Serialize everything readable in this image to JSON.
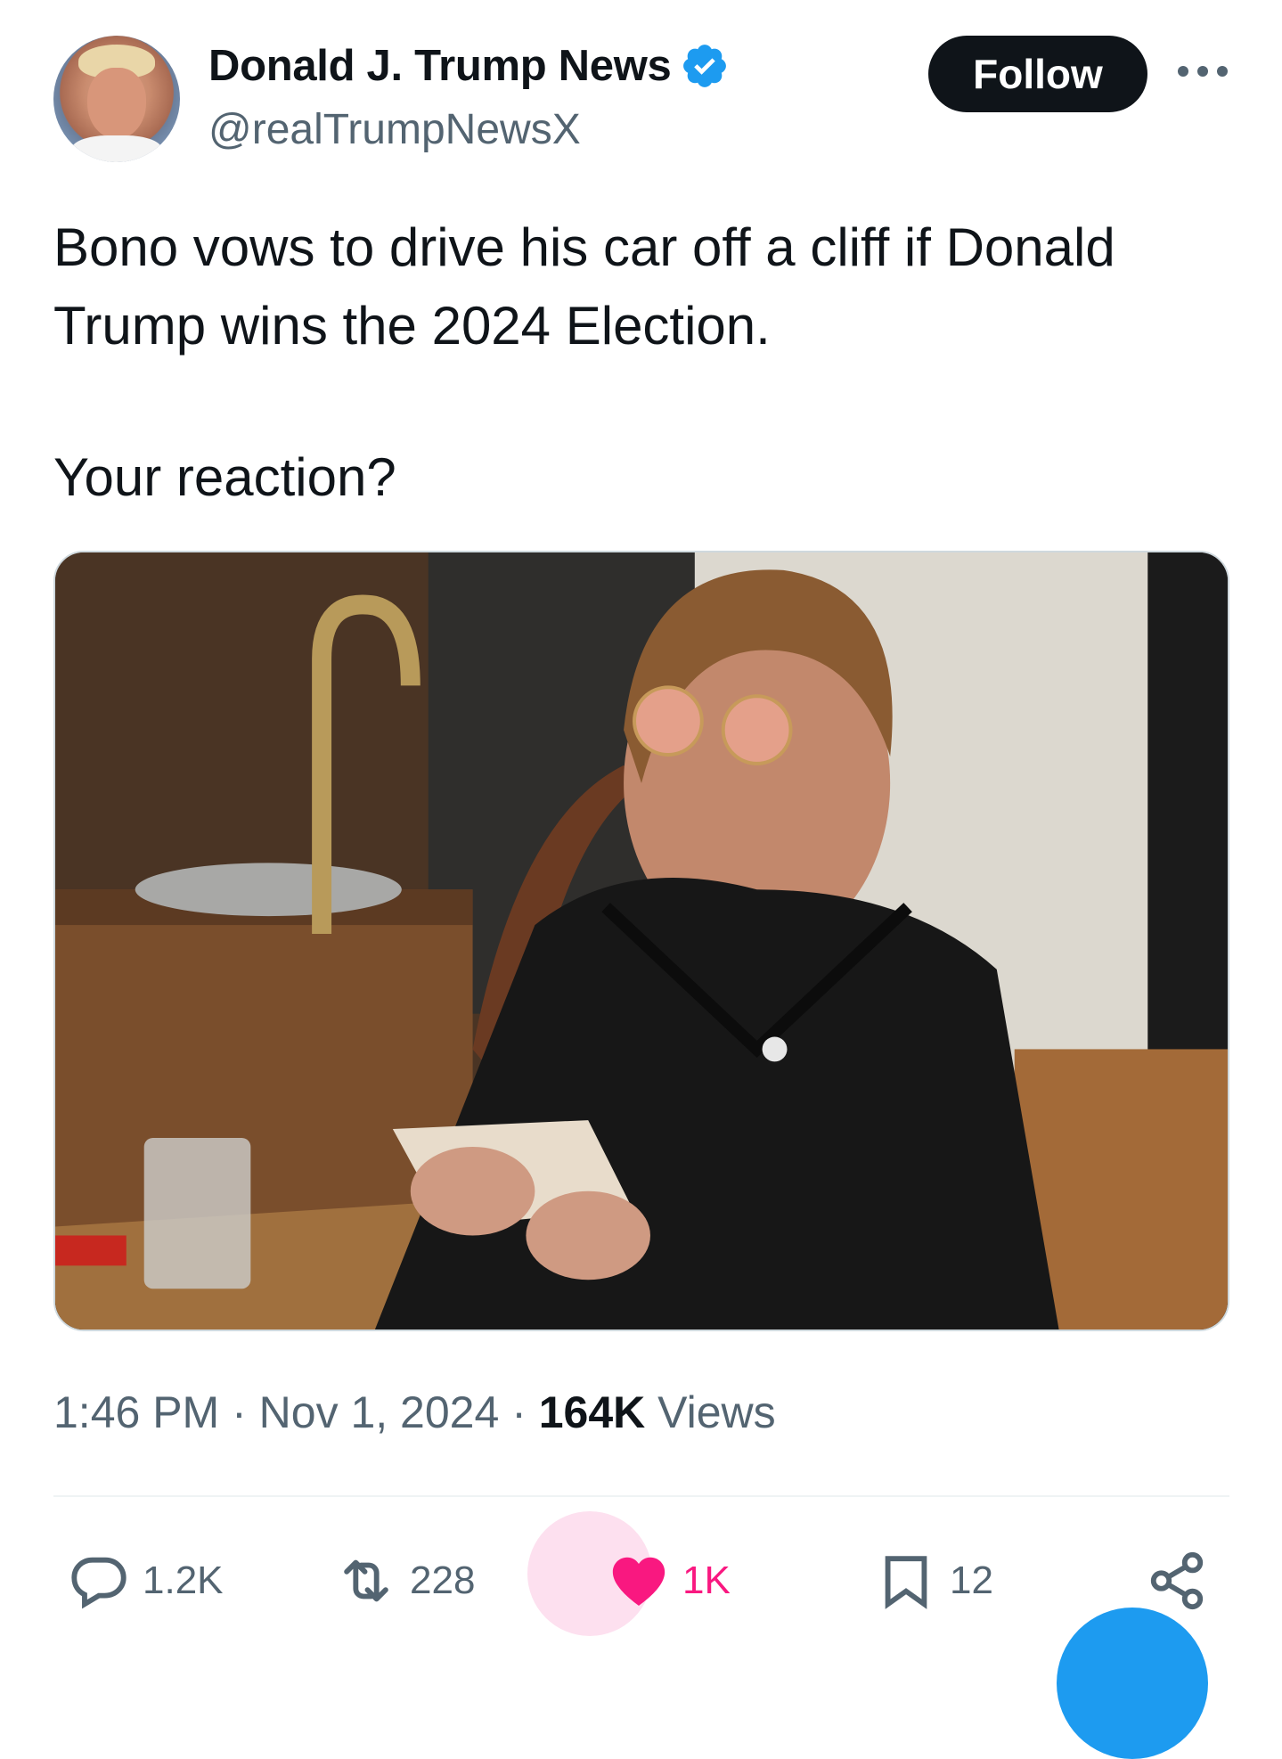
{
  "author": {
    "display_name": "Donald J. Trump News",
    "handle": "@realTrumpNewsX",
    "verified": true
  },
  "header": {
    "follow_label": "Follow"
  },
  "tweet": {
    "line1": "Bono vows to drive his car off a cliff if Donald Trump wins the 2024 Election.",
    "line2": "Your reaction?"
  },
  "meta": {
    "time": "1:46 PM",
    "sep1": " · ",
    "date": "Nov 1, 2024",
    "sep2": " · ",
    "views_count": "164K",
    "views_label": " Views"
  },
  "actions": {
    "replies": "1.2K",
    "reposts": "228",
    "likes": "1K",
    "bookmarks": "12"
  },
  "colors": {
    "accent": "#1d9bf0",
    "like": "#f91880",
    "text": "#0f1419",
    "muted": "#536471"
  }
}
